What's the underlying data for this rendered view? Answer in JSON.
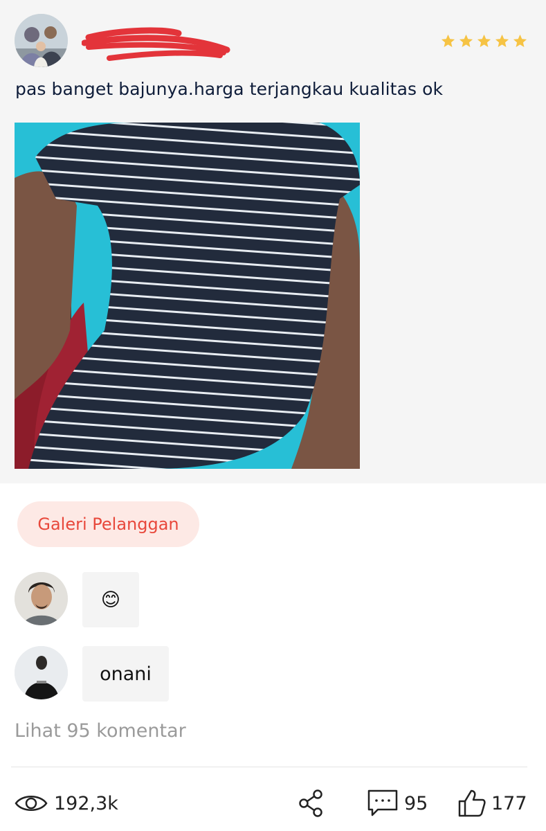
{
  "review": {
    "reviewer_avatar": "family-photo-avatar",
    "reviewer_name": "",
    "name_redacted": true,
    "rating": 5,
    "rating_max": 5,
    "star_color": "#f6c344",
    "text": "pas banget bajunya.harga terjangkau kualitas ok",
    "photo": "striped-dress-photo"
  },
  "gallery_chip": {
    "label": "Galeri Pelanggan",
    "bg_color": "#fde9e5",
    "text_color": "#e8483b"
  },
  "comments": [
    {
      "avatar": "man-avatar",
      "text": "😊"
    },
    {
      "avatar": "dark-shirt-man-avatar",
      "text": "onani"
    }
  ],
  "see_all_comments": "Lihat 95 komentar",
  "footer": {
    "views": "192,3k",
    "comments": "95",
    "likes": "177",
    "icons": [
      "eye-icon",
      "share-icon",
      "comment-icon",
      "thumbs-up-icon"
    ]
  },
  "colors": {
    "redaction": "#e3343a",
    "card_bg": "#f5f5f5",
    "muted_text": "#9a9a9a"
  }
}
